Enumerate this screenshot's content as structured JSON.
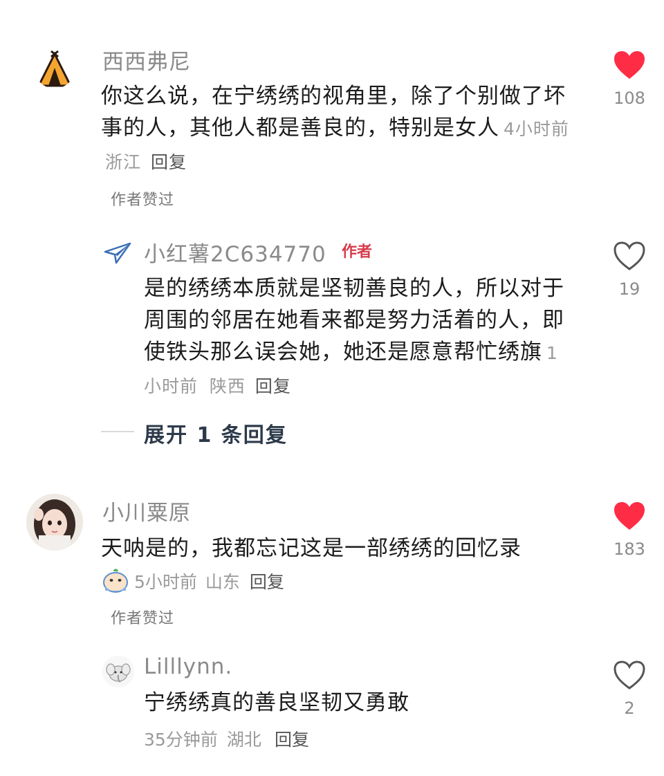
{
  "comments": [
    {
      "username": "西西弗尼",
      "text": "你这么说，在宁绣绣的视角里，除了个别做了坏事的人，其他人都是善良的，特别是女人",
      "time": "4小时前",
      "location": "浙江",
      "reply_label": "回复",
      "likes": "108",
      "liked": true,
      "author_liked": "作者赞过"
    },
    {
      "username": "小红薯2C634770",
      "author_badge": "作者",
      "text": "是的绣绣本质就是坚韧善良的人，所以对于周围的邻居在她看来都是努力活着的人，即使铁头那么误会她，她还是愿意帮忙绣旗",
      "time": "1小时前",
      "location": "陕西",
      "reply_label": "回复",
      "likes": "19",
      "liked": false
    },
    {
      "expand_label": "展开 1 条回复"
    },
    {
      "username": "小川粟原",
      "text": "天呐是的，我都忘记这是一部绣绣的回忆录",
      "time": "5小时前",
      "location": "山东",
      "reply_label": "回复",
      "likes": "183",
      "liked": true,
      "author_liked": "作者赞过"
    },
    {
      "username": "Lilllynn.",
      "text": "宁绣绣真的善良坚韧又勇敢",
      "time": "35分钟前",
      "location": "湖北",
      "reply_label": "回复",
      "likes": "2",
      "liked": false
    }
  ],
  "colors": {
    "heart_liked": "#fe2c45",
    "heart_outline": "#555555",
    "author_tag": "#d83b4a"
  },
  "icons": [
    "tent-avatar",
    "paper-plane-avatar",
    "girl-photo-avatar",
    "elephant-avatar",
    "crying-emoji-icon",
    "heart-icon"
  ]
}
